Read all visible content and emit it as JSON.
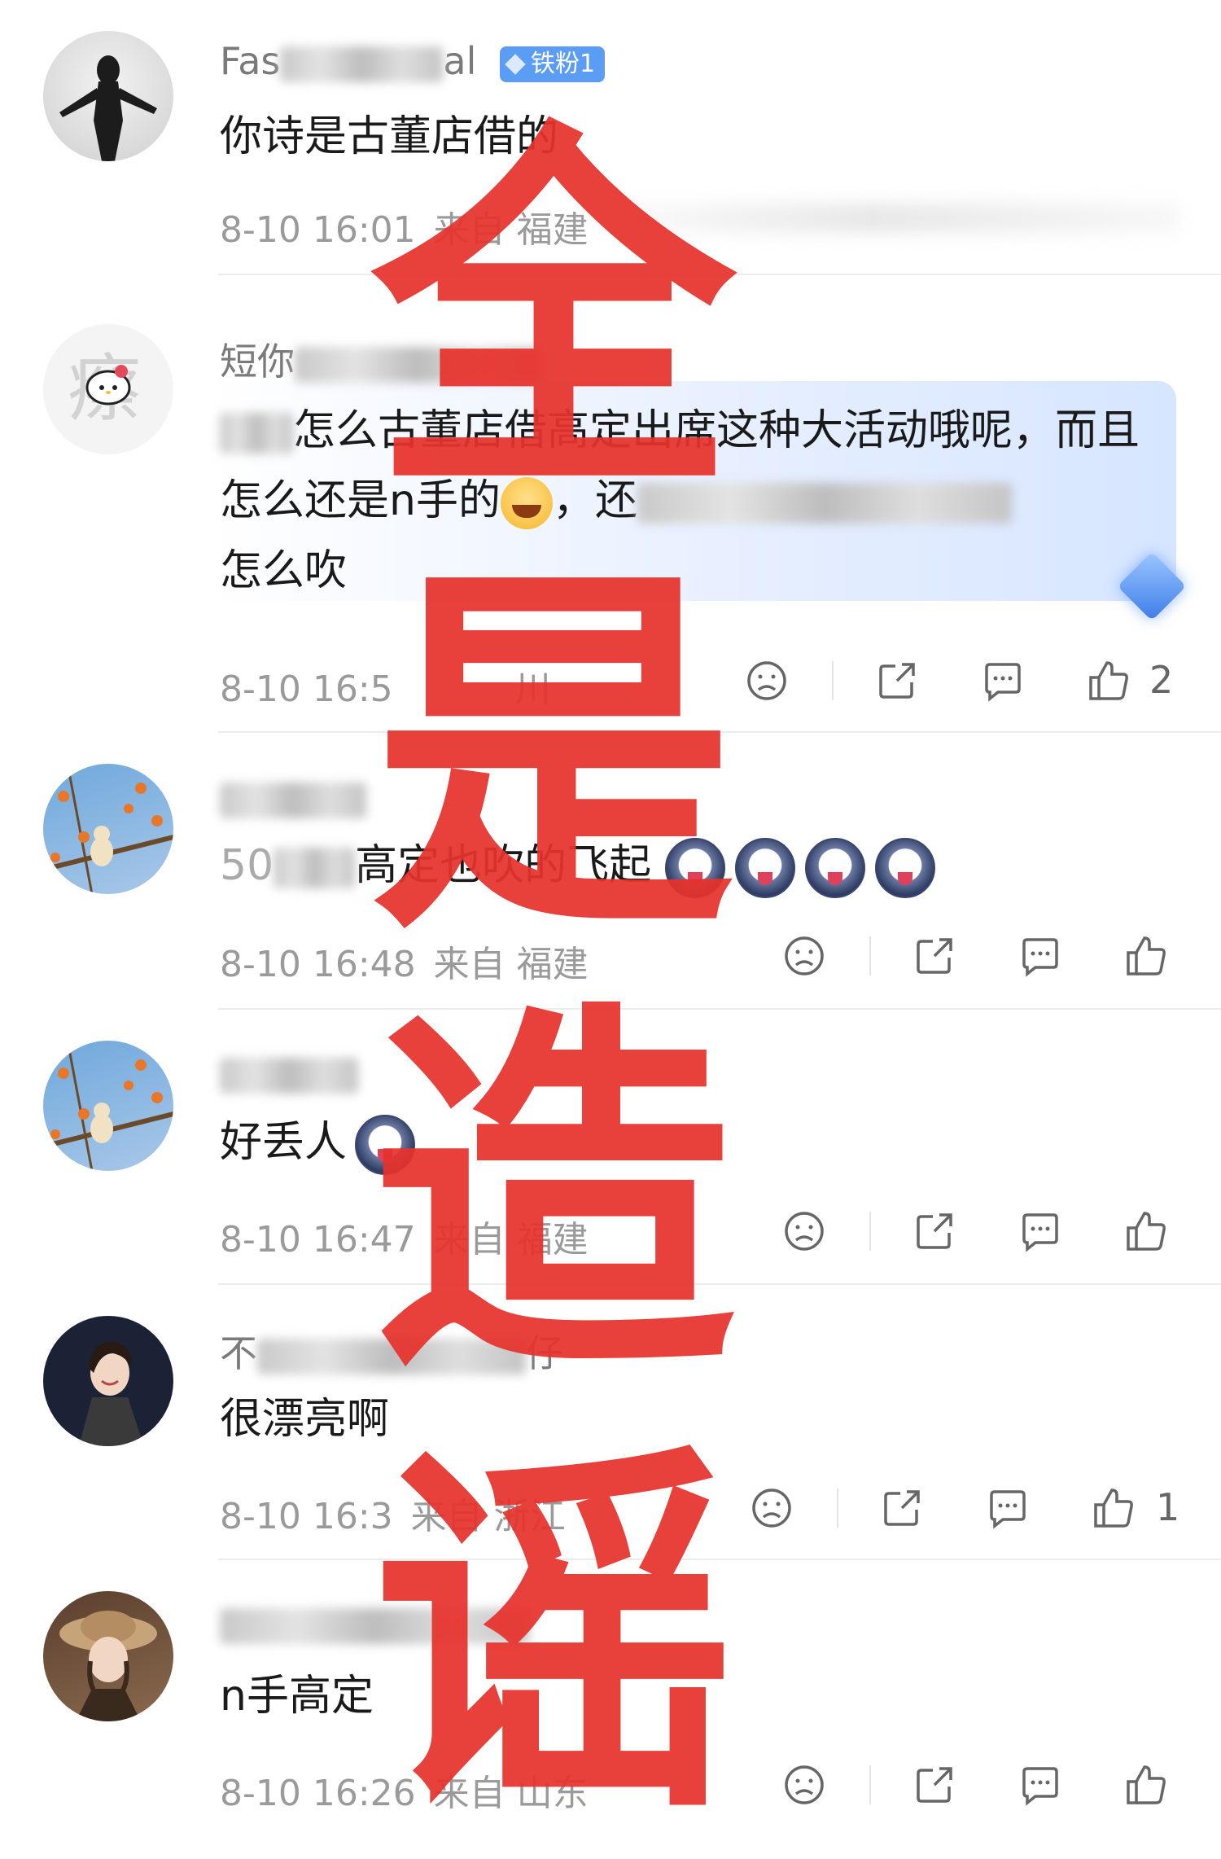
{
  "comments": [
    {
      "username_visible": "Fas",
      "username_suffix": "al",
      "badge": "铁粉1",
      "text": "你诗是古董店借的",
      "date": "8-10 16:01",
      "location": "来自 福建",
      "likes": "",
      "avatar_icon": "woman-silhouette-avatar"
    },
    {
      "username_visible": "短你",
      "text": "怎么古董店借高定出席这种大活动哦呢，而且怎么还是n手的",
      "text_end": "，还",
      "text_line3": "怎么吹",
      "date": "8-10 16:5",
      "location": "川",
      "likes": "2",
      "avatar_icon": "hello-kitty-avatar"
    },
    {
      "username_visible": "",
      "text": "高定也吹的飞起",
      "text_prefix": "50",
      "date": "8-10 16:48",
      "location": "来自 福建",
      "likes": "",
      "avatar_icon": "cat-in-persimmon-tree-avatar"
    },
    {
      "username_visible": "",
      "text": "好丢人",
      "date": "8-10 16:47",
      "location": "来自 福建",
      "likes": "",
      "avatar_icon": "cat-in-persimmon-tree-avatar"
    },
    {
      "username_visible": "不",
      "username_suffix": "仔",
      "text": "很漂亮啊",
      "date": "8-10 16:3",
      "location": "来自 浙江",
      "likes": "1",
      "avatar_icon": "smiling-woman-avatar"
    },
    {
      "username_visible": "",
      "text": "n手高定",
      "date": "8-10 16:26",
      "location": "来自 山东",
      "likes": "",
      "avatar_icon": "vintage-hat-woman-avatar"
    }
  ],
  "overlay": {
    "line1": "全",
    "line2": "是",
    "line3": "造",
    "line4": "谣"
  },
  "colors": {
    "overlay_red": "#e7322c",
    "badge_blue": "#5b9df5",
    "meta_gray": "#9a9a9a"
  }
}
